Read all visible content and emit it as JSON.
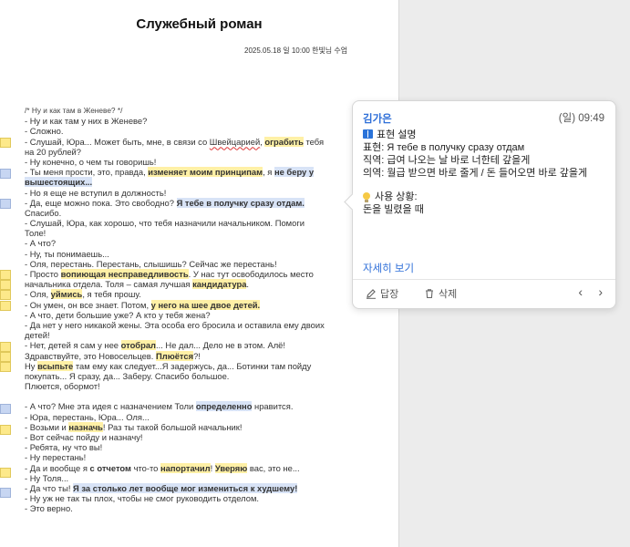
{
  "document": {
    "title": "Служебный роман",
    "meta": "2025.05.18 일 10:00  한빛님 수업",
    "comment_line": "/* Ну и как там в Женеве? */",
    "lines": [
      [
        "- Ну и как там у них в Женеве?"
      ],
      [
        "- Сложно."
      ],
      [
        "- Слушай, Юра... Может быть, мне, в связи со ",
        "Швейцарией",
        ", ",
        "ограбить",
        " тебя"
      ],
      [
        "на 20 рублей?"
      ],
      [
        "- Ну конечно, о чем ты говоришь!"
      ],
      [
        "- Ты меня прости, это, правда, ",
        "изменяет моим принципам",
        ", я ",
        "не беру у"
      ],
      [
        "вышестоящих..."
      ],
      [
        "- Но я еще не вступил в должность!"
      ],
      [
        "- Да, еще можно пока. Это свободно? ",
        "Я тебе в получку сразу отдам."
      ],
      [
        "Спасибо."
      ],
      [
        "- Слушай, Юра, как хорошо, что тебя назначили начальником. Помоги"
      ],
      [
        "Толе!"
      ],
      [
        "- А что?"
      ],
      [
        "- Ну, ты понимаешь..."
      ],
      [
        "- Оля, перестань. Перестань, слышишь? Сейчас же перестань!"
      ],
      [
        "- Просто ",
        "вопиющая несправедливость",
        ". У нас тут освободилось место"
      ],
      [
        "начальника отдела. Толя – самая лучшая ",
        "кандидатура",
        "."
      ],
      [
        "- Оля, ",
        "уймись",
        ", я тебя прошу."
      ],
      [
        "- Он умен, он все знает. Потом, ",
        "у него на шее двое детей."
      ],
      [
        "- А что, дети большие уже? А кто у тебя жена?"
      ],
      [
        "- Да нет у него никакой жены. Эта особа его бросила и оставила ему двоих"
      ],
      [
        "детей!"
      ],
      [
        "- Нет, детей я сам у нее ",
        "отобрал",
        "... Не дал... Дело не в этом. Алё!"
      ],
      [
        "Здравствуйте, это Новосельцев. ",
        "Плюётся",
        "?!"
      ],
      [
        "Ну ",
        "всыпьте",
        " там ему как следует...Я задержусь, да... Ботинки там пойду"
      ],
      [
        "покупать... Я сразу, да... Заберу. Спасибо большое."
      ],
      [
        "Плюется, обормот!"
      ],
      [
        ""
      ],
      [
        "- А что? Мне эта идея с назначением Толи ",
        "определенно",
        " нравится."
      ],
      [
        "- Юра, перестань, Юра... Оля..."
      ],
      [
        "- Возьми и ",
        "назначь",
        "! Раз ты такой большой начальник!"
      ],
      [
        "- Вот сейчас пойду и назначу!"
      ],
      [
        "- Ребята, ну что вы!"
      ],
      [
        "- Ну перестань!"
      ],
      [
        "- Да и вообще я ",
        "с отчетом",
        " что-то ",
        "напортачил",
        "! ",
        "Уверяю",
        " вас, это не..."
      ],
      [
        "- Ну Толя..."
      ],
      [
        "- Да что ты! ",
        "Я за столько лет вообще мог измениться к худшему!"
      ],
      [
        "- Ну уж не так ты плох, чтобы не смог руководить отделом."
      ],
      [
        "- Это верно."
      ]
    ]
  },
  "comment_popup": {
    "author": "김가은",
    "time": "(일) 09:49",
    "heading": "표현 설명",
    "expression": "표현: Я тебе в получку сразу отдам",
    "literal": "직역: 급여 나오는 날 바로 너한테 갚을게",
    "meaning": "의역: 월급 받으면 바로 줄게 / 돈 들어오면 바로 갚을게",
    "usage_heading": "사용 상황:",
    "usage": "돈을 빌렸을 때",
    "more_label": "자세히 보기",
    "reply_label": "답장",
    "delete_label": "삭제"
  },
  "colors": {
    "accent": "#2f6fd8",
    "yellow_highlight": "#fff0a6",
    "blue_highlight": "#d8e3f6"
  }
}
